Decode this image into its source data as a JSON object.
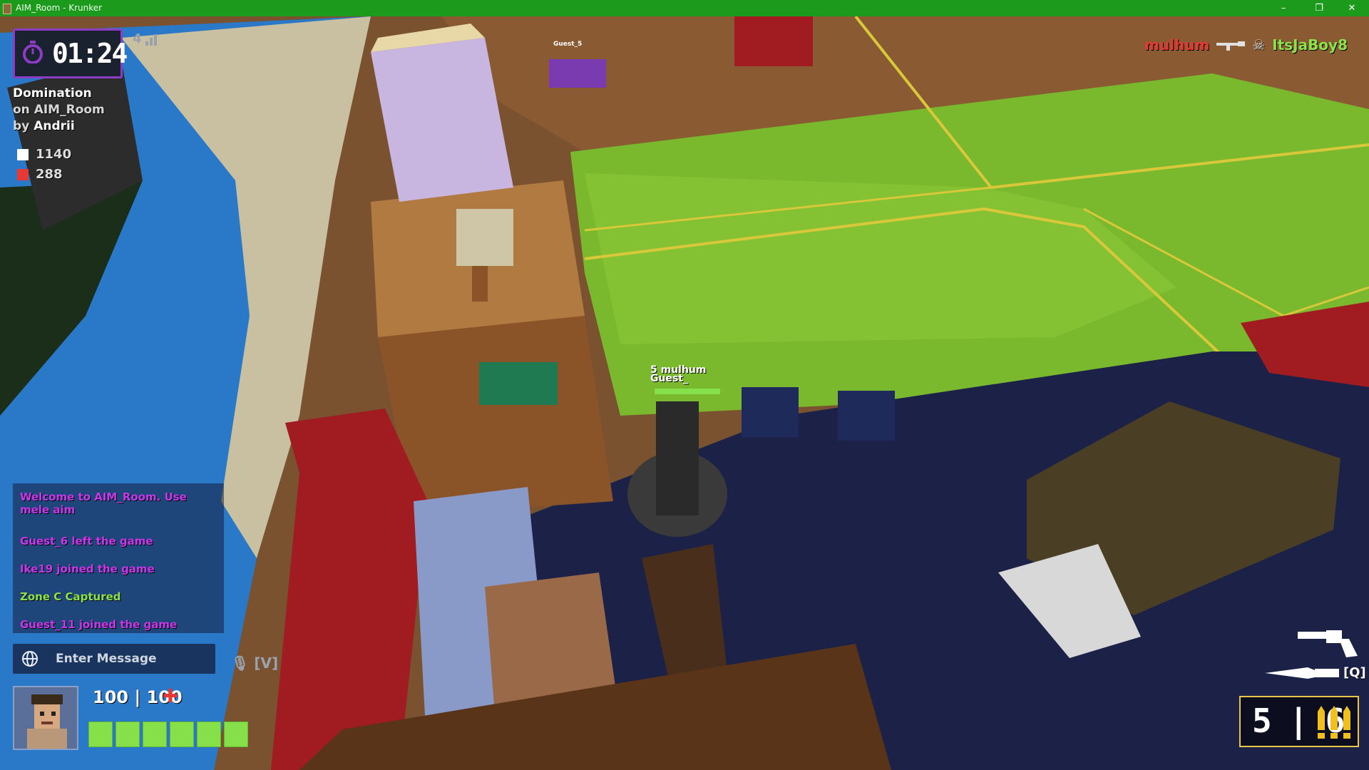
{
  "window": {
    "title": "AIM_Room - Krunker",
    "minimize_glyph": "–",
    "restore_glyph": "❐",
    "close_glyph": "✕"
  },
  "hud": {
    "timer": "01:24",
    "ping": "4",
    "mode": "Domination",
    "map_line": "on AIM_Room",
    "author_prefix": "by",
    "author": "Andrii",
    "team_scores": [
      {
        "value": "1140",
        "color": "#ffffff"
      },
      {
        "value": "288",
        "color": "#e53935"
      }
    ],
    "killfeed": {
      "killer": "mulhum",
      "weapon_icon": "rifle-icon",
      "kill_icon": "skull-icon",
      "victim": "ItsJaBoy8"
    },
    "enemy_nametag": [
      "5 mulhum",
      "Guest_"
    ],
    "far_tag": "Guest_5",
    "health": {
      "current": "100",
      "max": "100",
      "display": "100 | 100",
      "segments": 6,
      "fill_fraction": 1.0
    },
    "ammo": {
      "display": "5 | 6",
      "bullets_icon": "bullets-icon"
    },
    "weapon_slots": [
      {
        "icon": "revolver-icon"
      },
      {
        "icon": "knife-icon",
        "key": "[Q]"
      }
    ]
  },
  "chat": {
    "messages": [
      {
        "text": "Welcome to AIM_Room. Use mele aim",
        "color": "#c837e8"
      },
      {
        "text": "Guest_6 left the game",
        "color": "#c837e8"
      },
      {
        "text": "Ike19 joined the game",
        "color": "#c837e8"
      },
      {
        "text": "Zone C Captured",
        "color": "#8be24a"
      },
      {
        "text": "Guest_11 joined the game",
        "color": "#c837e8"
      }
    ],
    "input_placeholder": "Enter Message",
    "mic_hint": "🎙 [V]",
    "globe_icon": "globe-icon"
  },
  "colors": {
    "accent_purple": "#8d3cc8",
    "health_green": "#86e04a",
    "ammo_border": "#e8c84a",
    "team_red": "#e53935"
  }
}
